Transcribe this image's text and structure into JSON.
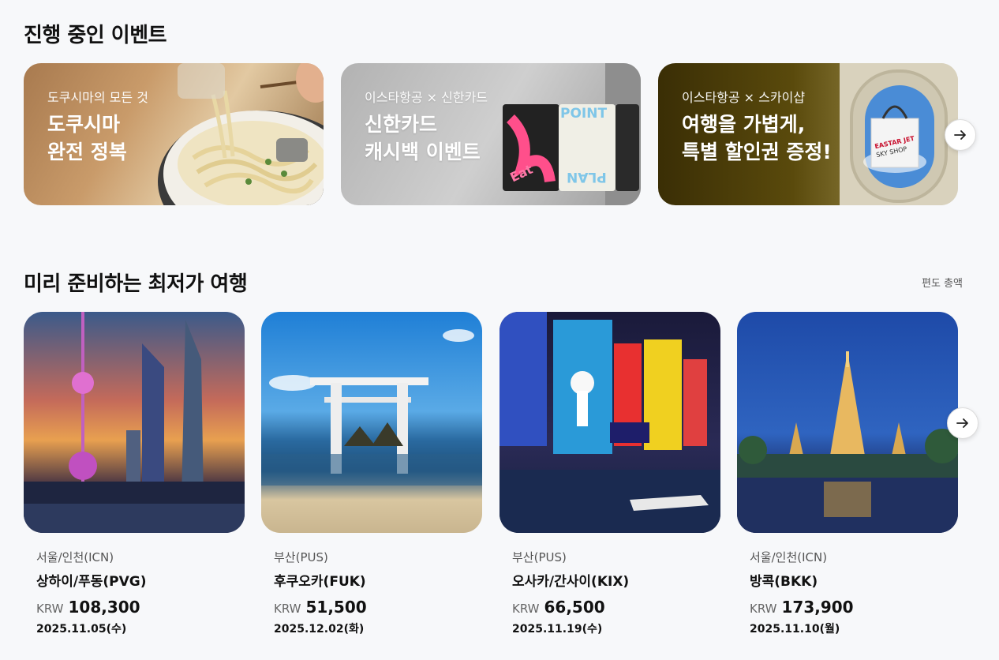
{
  "events": {
    "title": "진행 중인 이벤트",
    "banners": [
      {
        "sub": "도쿠시마의 모든 것",
        "line1": "도쿠시마",
        "line2": "완전 정복"
      },
      {
        "sub": "이스타항공 × 신한카드",
        "line1": "신한카드",
        "line2": "캐시백 이벤트",
        "card_texts": [
          "Eat",
          "POINT",
          "PLAN"
        ]
      },
      {
        "sub": "이스타항공 × 스카이샵",
        "line1": "여행을 가볍게,",
        "line2": "특별 할인권 증정!",
        "bag_texts": [
          "EASTAR JET",
          "SKY SHOP"
        ]
      }
    ],
    "next_icon": "arrow-right-icon"
  },
  "deals": {
    "title": "미리 준비하는 최저가 여행",
    "hint": "편도 총액",
    "next_icon": "arrow-right-icon",
    "cards": [
      {
        "origin": "서울/인천(ICN)",
        "dest": "상하이/푸동(PVG)",
        "currency": "KRW",
        "price": "108,300",
        "date": "2025.11.05(수)"
      },
      {
        "origin": "부산(PUS)",
        "dest": "후쿠오카(FUK)",
        "currency": "KRW",
        "price": "51,500",
        "date": "2025.12.02(화)"
      },
      {
        "origin": "부산(PUS)",
        "dest": "오사카/간사이(KIX)",
        "currency": "KRW",
        "price": "66,500",
        "date": "2025.11.19(수)"
      },
      {
        "origin": "서울/인천(ICN)",
        "dest": "방콕(BKK)",
        "currency": "KRW",
        "price": "173,900",
        "date": "2025.11.10(월)"
      }
    ]
  }
}
